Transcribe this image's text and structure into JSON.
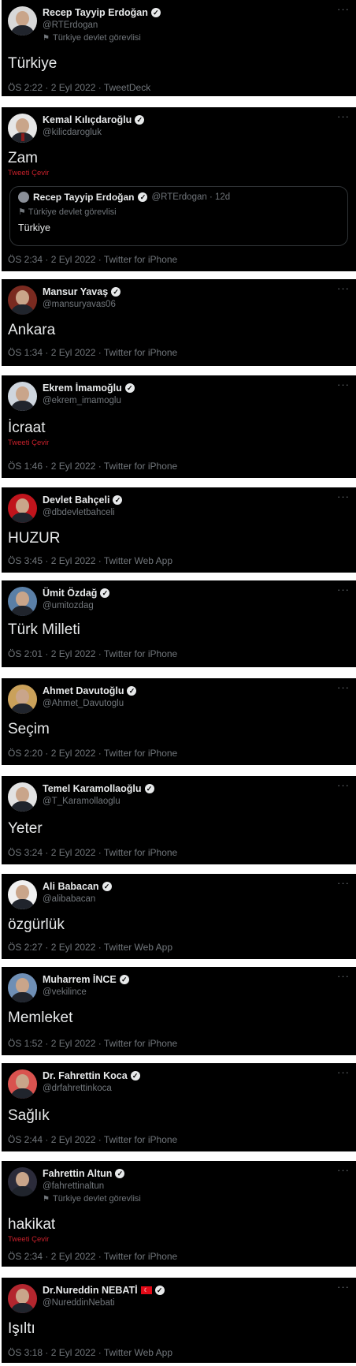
{
  "tweets": [
    {
      "name": "Recep Tayyip Erdoğan",
      "handle": "@RTErdogan",
      "affiliation": "Türkiye devlet görevlisi",
      "text": "Türkiye",
      "translate": "",
      "meta": "ÖS 2:22 · 2 Eyl 2022 · TweetDeck",
      "flag": ""
    },
    {
      "name": "Kemal Kılıçdaroğlu",
      "handle": "@kilicdarogluk",
      "affiliation": "",
      "text": "Zam",
      "translate": "Tweeti Çevir",
      "meta": "ÖS 2:34 · 2 Eyl 2022 · Twitter for iPhone",
      "flag": "",
      "quote": {
        "name": "Recep Tayyip Erdoğan",
        "handle": "@RTErdogan · 12d",
        "affiliation": "Türkiye devlet görevlisi",
        "text": "Türkiye"
      }
    },
    {
      "name": "Mansur Yavaş",
      "handle": "@mansuryavas06",
      "affiliation": "",
      "text": "Ankara",
      "translate": "",
      "meta": "ÖS 1:34 · 2 Eyl 2022 · Twitter for iPhone",
      "flag": ""
    },
    {
      "name": "Ekrem İmamoğlu",
      "handle": "@ekrem_imamoglu",
      "affiliation": "",
      "text": "İcraat",
      "translate": "Tweeti Çevir",
      "meta": "ÖS 1:46 · 2 Eyl 2022 · Twitter for iPhone",
      "flag": ""
    },
    {
      "name": "Devlet Bahçeli",
      "handle": "@dbdevletbahceli",
      "affiliation": "",
      "text": "HUZUR",
      "translate": "",
      "meta": "ÖS 3:45 · 2 Eyl 2022 · Twitter Web App",
      "flag": ""
    },
    {
      "name": "Ümit Özdağ",
      "handle": "@umitozdag",
      "affiliation": "",
      "text": "Türk Milleti",
      "translate": "",
      "meta": "ÖS 2:01 · 2 Eyl 2022 · Twitter for iPhone",
      "flag": ""
    },
    {
      "name": "Ahmet Davutoğlu",
      "handle": "@Ahmet_Davutoglu",
      "affiliation": "",
      "text": "Seçim",
      "translate": "",
      "meta": "ÖS 2:20 · 2 Eyl 2022 · Twitter for iPhone",
      "flag": ""
    },
    {
      "name": "Temel Karamollaoğlu",
      "handle": "@T_Karamollaoglu",
      "affiliation": "",
      "text": "Yeter",
      "translate": "",
      "meta": "ÖS 3:24 · 2 Eyl 2022 · Twitter for iPhone",
      "flag": ""
    },
    {
      "name": "Ali Babacan",
      "handle": "@alibabacan",
      "affiliation": "",
      "text": "özgürlük",
      "translate": "",
      "meta": "ÖS 2:27 · 2 Eyl 2022 · Twitter Web App",
      "flag": ""
    },
    {
      "name": "Muharrem İNCE",
      "handle": "@vekilince",
      "affiliation": "",
      "text": "Memleket",
      "translate": "",
      "meta": "ÖS 1:52 · 2 Eyl 2022 · Twitter for iPhone",
      "flag": ""
    },
    {
      "name": "Dr. Fahrettin Koca",
      "handle": "@drfahrettinkoca",
      "affiliation": "",
      "text": "Sağlık",
      "translate": "",
      "meta": "ÖS 2:44 · 2 Eyl 2022 · Twitter for iPhone",
      "flag": ""
    },
    {
      "name": "Fahrettin Altun",
      "handle": "@fahrettinaltun",
      "affiliation": "Türkiye devlet görevlisi",
      "text": "hakikat",
      "translate": "Tweeti Çevir",
      "meta": "ÖS 2:34 · 2 Eyl 2022 · Twitter for iPhone",
      "flag": ""
    },
    {
      "name": "Dr.Nureddin NEBATİ",
      "handle": "@NureddinNebati",
      "affiliation": "",
      "text": "Işıltı",
      "translate": "",
      "meta": "ÖS 3:18 · 2 Eyl 2022 · Twitter Web App",
      "flag": "☾"
    }
  ],
  "icons": {
    "verified": "verified-check-icon",
    "more": "more-dots-icon",
    "affiliation": "flag-icon"
  },
  "glyphs": {
    "more": "···",
    "verified": "✓",
    "affiliation": "⚑"
  },
  "colors": {
    "background": "#000000",
    "text": "#e7e9ea",
    "muted": "#71767b",
    "translate": "#c8202b",
    "border": "#2f3336"
  }
}
